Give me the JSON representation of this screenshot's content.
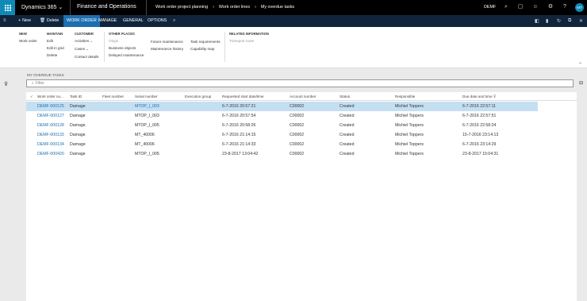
{
  "topbar": {
    "app_name": "Dynamics 365",
    "app_chevron": "⌄",
    "module": "Finance and Operations",
    "breadcrumb": [
      "Work order project planning",
      "Work order lines",
      "My overdue tasks"
    ],
    "crumb_sep": "›",
    "company": "DEMF",
    "user_initials": "MT",
    "icons": [
      "search-icon",
      "chat-icon",
      "smiley-icon",
      "gear-icon",
      "help-icon"
    ]
  },
  "actionbar": {
    "new_label": "New",
    "new_icon": "+",
    "delete_label": "Delete",
    "delete_icon": "🗑",
    "tabs": [
      "WORK ORDER",
      "MANAGE",
      "GENERAL",
      "OPTIONS"
    ],
    "active_tab": "WORK ORDER",
    "accent": "#1d6fb0"
  },
  "ribbon": {
    "new": {
      "header": "NEW",
      "items": [
        "Work order"
      ]
    },
    "maintain": {
      "header": "MAINTAIN",
      "items": [
        "Edit",
        "Edit in grid",
        "Delete"
      ]
    },
    "customer": {
      "header": "CUSTOMER",
      "items": [
        "Activities",
        "Cases",
        "Contact details"
      ]
    },
    "other_places": {
      "header": "OTHER PLACES",
      "col1": [
        "Origin",
        "Business objects",
        "Delayed maintenance"
      ],
      "col2": [
        "Future maintenance",
        "Maintenance history"
      ],
      "col3": [
        "Task requirements",
        "Capability map"
      ]
    },
    "related": {
      "header": "RELATED INFORMATION",
      "items": [
        "Transport route"
      ]
    }
  },
  "panel": {
    "title": "MY OVERDUE TASKS",
    "filter_placeholder": "Filter"
  },
  "grid": {
    "columns": [
      "Work order nu...",
      "Task ID",
      "Fleet number",
      "Serial number",
      "Execution group",
      "Requested start date/time",
      "Account number",
      "Status",
      "Responsible",
      "Due date and time"
    ],
    "rows": [
      {
        "wo": "DEMF-000125",
        "task": "Damage",
        "fleet": "",
        "serial": "MTOP_I_003",
        "exec": "",
        "start": "6-7-2016 20:57:21",
        "account": "C00002",
        "status": "Created",
        "resp": "Michiel Toppers",
        "due": "6-7-2016 22:57:11",
        "selected": true
      },
      {
        "wo": "DEMF-000127",
        "task": "Damage",
        "fleet": "",
        "serial": "MTOP_I_003",
        "exec": "",
        "start": "6-7-2016 20:57:54",
        "account": "C00002",
        "status": "Created",
        "resp": "Michiel Toppers",
        "due": "6-7-2016 22:57:51",
        "selected": false
      },
      {
        "wo": "DEMF-000128",
        "task": "Damage",
        "fleet": "",
        "serial": "MTOP_I_005",
        "exec": "",
        "start": "6-7-2016 20:58:26",
        "account": "C00002",
        "status": "Created",
        "resp": "Michiel Toppers",
        "due": "6-7-2016 22:58:24",
        "selected": false
      },
      {
        "wo": "DEMF-000133",
        "task": "Damage",
        "fleet": "",
        "serial": "MT_40006",
        "exec": "",
        "start": "6-7-2016 21:14:15",
        "account": "C00002",
        "status": "Created",
        "resp": "Michiel Toppers",
        "due": "15-7-2016 23:14:13",
        "selected": false
      },
      {
        "wo": "DEMF-000134",
        "task": "Damage",
        "fleet": "",
        "serial": "MT_40006",
        "exec": "",
        "start": "6-7-2016 21:14:33",
        "account": "C00002",
        "status": "Created",
        "resp": "Michiel Toppers",
        "due": "6-7-2016 23:14:29",
        "selected": false
      },
      {
        "wo": "DEMF-000420",
        "task": "Damage",
        "fleet": "",
        "serial": "MTOP_I_005",
        "exec": "",
        "start": "23-8-2017 13:04:42",
        "account": "C00002",
        "status": "Created",
        "resp": "Michiel Toppers",
        "due": "23-8-2017 15:04:31",
        "selected": false
      }
    ],
    "selected_color": "#c5dff2"
  }
}
